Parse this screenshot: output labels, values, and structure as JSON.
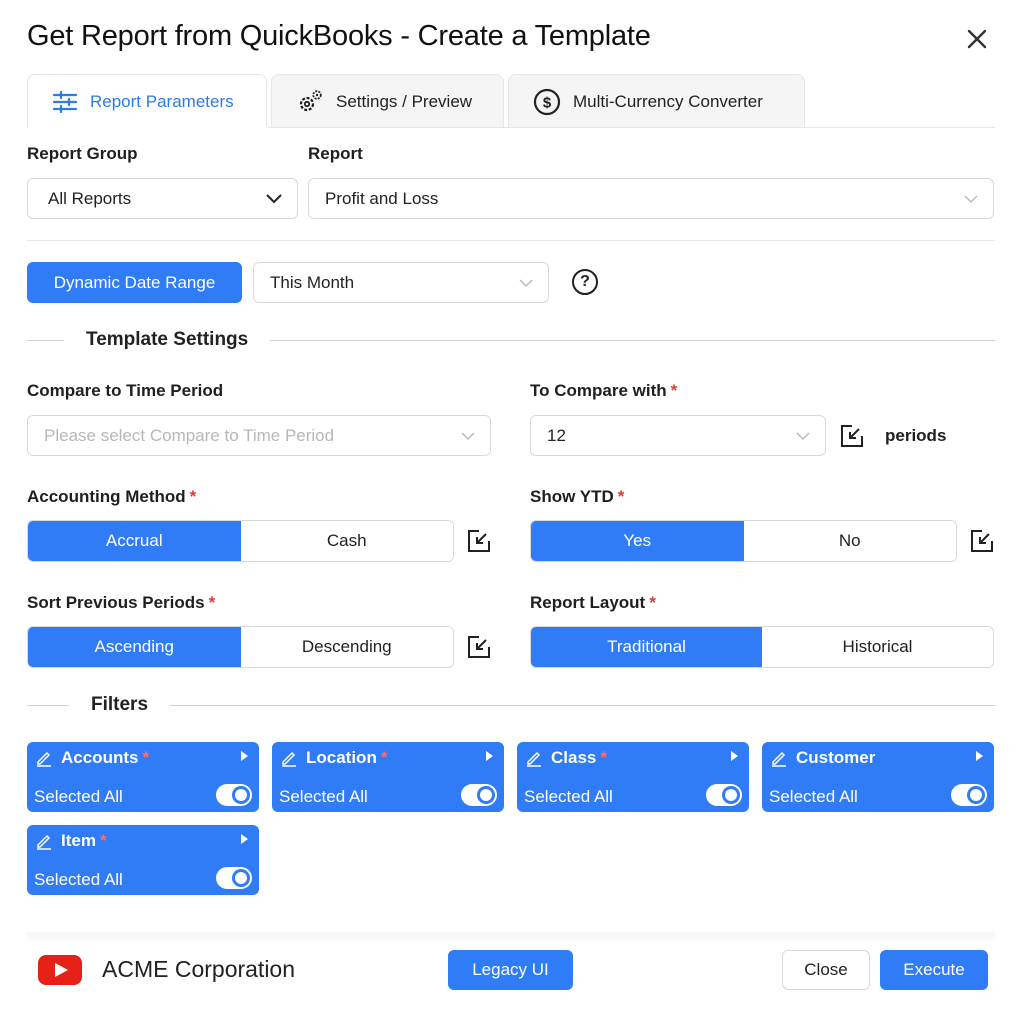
{
  "dialog": {
    "title": "Get Report from QuickBooks - Create a Template"
  },
  "tabs": [
    {
      "label": "Report Parameters",
      "icon": "sliders-icon",
      "active": true
    },
    {
      "label": "Settings / Preview",
      "icon": "gears-icon",
      "active": false
    },
    {
      "label": "Multi-Currency Converter",
      "icon": "dollar-circle-icon",
      "active": false
    }
  ],
  "report_group": {
    "label": "Report Group",
    "value": "All Reports"
  },
  "report": {
    "label": "Report",
    "value": "Profit and Loss"
  },
  "date_range": {
    "button_label": "Dynamic Date Range",
    "value": "This Month",
    "help_glyph": "?"
  },
  "template_settings": {
    "title": "Template Settings",
    "compare_time_period": {
      "label": "Compare to Time Period",
      "placeholder": "Please select Compare to Time Period"
    },
    "compare_with": {
      "label": "To Compare with",
      "required": "*",
      "value": "12",
      "suffix": "periods"
    },
    "accounting_method": {
      "label": "Accounting Method",
      "required": "*",
      "options": [
        "Accrual",
        "Cash"
      ],
      "selected": "Accrual"
    },
    "show_ytd": {
      "label": "Show YTD",
      "required": "*",
      "options": [
        "Yes",
        "No"
      ],
      "selected": "Yes"
    },
    "sort_previous_periods": {
      "label": "Sort Previous Periods",
      "required": "*",
      "options": [
        "Ascending",
        "Descending"
      ],
      "selected": "Ascending"
    },
    "report_layout": {
      "label": "Report Layout",
      "required": "*",
      "options": [
        "Traditional",
        "Historical"
      ],
      "selected": "Traditional"
    }
  },
  "filters": {
    "title": "Filters",
    "items": [
      {
        "name": "Accounts",
        "required": "*",
        "status": "Selected All",
        "enabled": true
      },
      {
        "name": "Location",
        "required": "*",
        "status": "Selected All",
        "enabled": true
      },
      {
        "name": "Class",
        "required": "*",
        "status": "Selected All",
        "enabled": true
      },
      {
        "name": "Customer",
        "required": "",
        "status": "Selected All",
        "enabled": true
      },
      {
        "name": "Item",
        "required": "*",
        "status": "Selected All",
        "enabled": true
      }
    ]
  },
  "footer": {
    "company": "ACME Corporation",
    "legacy_label": "Legacy UI",
    "close_label": "Close",
    "execute_label": "Execute"
  },
  "colors": {
    "primary": "#2f7cf6",
    "required": "#e53935",
    "youtube_red": "#e62117"
  }
}
